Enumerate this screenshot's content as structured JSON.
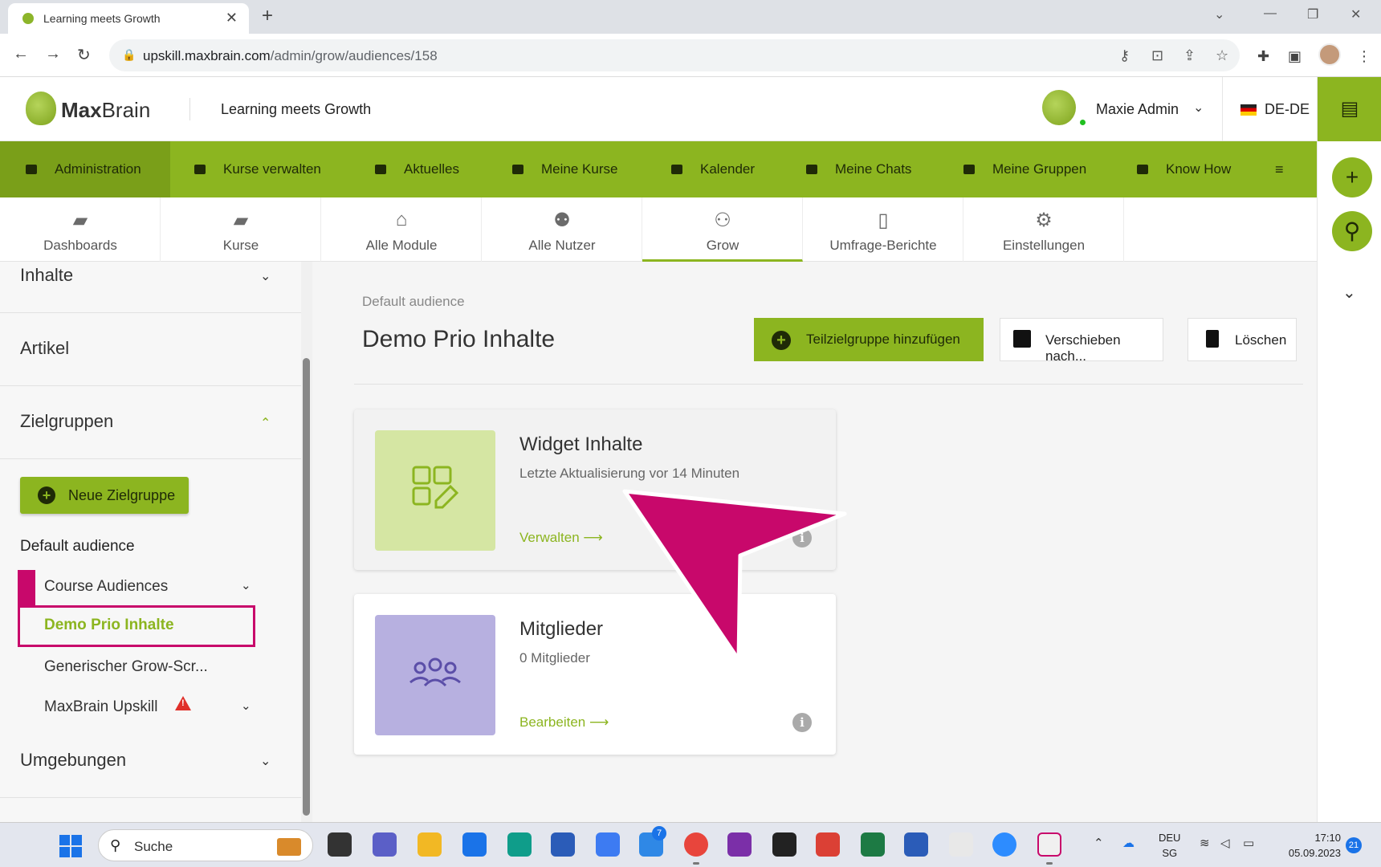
{
  "browser": {
    "tab_title": "Learning meets Growth",
    "url_host": "upskill.maxbrain.com",
    "url_path": "/admin/grow/audiences/158"
  },
  "header": {
    "logo_bold": "Max",
    "logo_light": "Brain",
    "title": "Learning meets Growth",
    "user_name": "Maxie Admin",
    "language": "DE-DE"
  },
  "main_nav": [
    {
      "label": "Administration",
      "icon": "admin-icon"
    },
    {
      "label": "Kurse verwalten",
      "icon": "courses-icon"
    },
    {
      "label": "Aktuelles",
      "icon": "news-icon"
    },
    {
      "label": "Meine Kurse",
      "icon": "graduation-cap-icon"
    },
    {
      "label": "Kalender",
      "icon": "calendar-icon"
    },
    {
      "label": "Meine Chats",
      "icon": "chat-icon"
    },
    {
      "label": "Meine Gruppen",
      "icon": "groups-icon"
    },
    {
      "label": "Know How",
      "icon": "book-icon"
    }
  ],
  "sub_nav": [
    {
      "label": "Dashboards",
      "icon": "dashboard-icon"
    },
    {
      "label": "Kurse",
      "icon": "book-icon"
    },
    {
      "label": "Alle Module",
      "icon": "institution-icon"
    },
    {
      "label": "Alle Nutzer",
      "icon": "users-icon"
    },
    {
      "label": "Grow",
      "icon": "audience-icon"
    },
    {
      "label": "Umfrage-Berichte",
      "icon": "report-icon"
    },
    {
      "label": "Einstellungen",
      "icon": "gears-icon"
    }
  ],
  "sidebar": {
    "section_inhalte": "Inhalte",
    "section_artikel": "Artikel",
    "section_zielgruppen": "Zielgruppen",
    "new_button": "Neue Zielgruppe",
    "group_label": "Default audience",
    "item_course_audiences": "Course Audiences",
    "item_active": "Demo Prio Inhalte",
    "item_generic": "Generischer Grow-Scr...",
    "item_upskill": "MaxBrain Upskill",
    "section_umgebungen": "Umgebungen"
  },
  "main": {
    "breadcrumb": "Default audience",
    "title": "Demo Prio Inhalte",
    "btn_add": "Teilzielgruppe hinzufügen",
    "btn_move": "Verschieben nach...",
    "btn_delete": "Löschen",
    "cards": [
      {
        "title": "Widget Inhalte",
        "subtitle": "Letzte Aktualisierung vor 14 Minuten",
        "link": "Verwalten",
        "color": "#d5e6a3"
      },
      {
        "title": "Mitglieder",
        "subtitle": "0 Mitglieder",
        "link": "Bearbeiten",
        "color": "#b7b0e0"
      }
    ]
  },
  "taskbar": {
    "search": "Suche",
    "badge_count": "7",
    "lang_top": "DEU",
    "lang_bottom": "SG",
    "time": "17:10",
    "date": "05.09.2023",
    "notifications": "21"
  },
  "colors": {
    "brand_green": "#8cb520",
    "annotation_magenta": "#c8086b"
  }
}
